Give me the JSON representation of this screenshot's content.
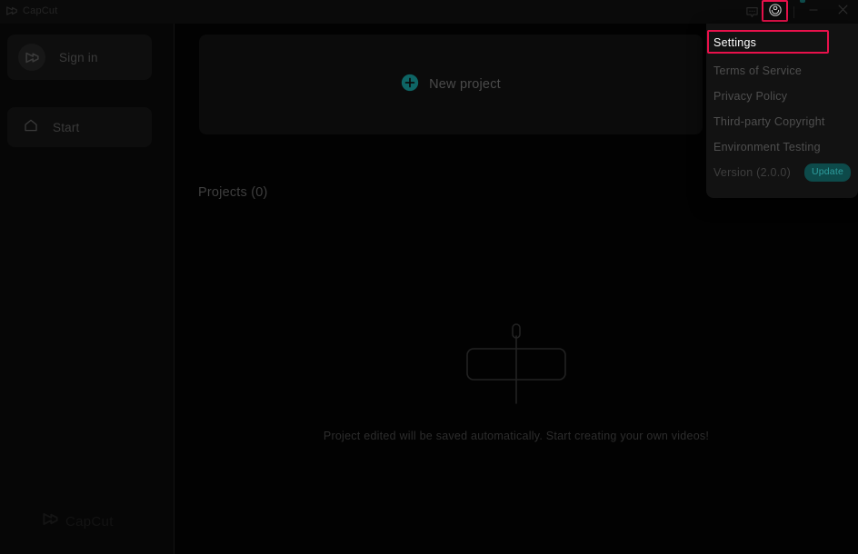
{
  "app": {
    "name": "CapCut",
    "accent_teal": "#0e7c7c",
    "highlight_red": "#e8114b",
    "window_bg": "#000000",
    "sidebar_bg": "#060606",
    "menu_bg": "#121212"
  },
  "titlebar": {
    "logo_text": "CapCut",
    "logo_icon": "capcut-logo-icon",
    "feedback_icon": "chat-bubble-icon",
    "settings_icon": "settings-gear-icon",
    "minimize_icon": "minimize-icon",
    "close_icon": "close-icon"
  },
  "sidebar": {
    "signin": {
      "label": "Sign in",
      "icon": "capcut-avatar-icon"
    },
    "start": {
      "label": "Start",
      "icon": "home-icon"
    },
    "watermark": {
      "text": "CapCut",
      "icon": "capcut-logo-icon"
    }
  },
  "main": {
    "new_project": {
      "label": "New project",
      "icon": "plus-circle-icon"
    },
    "projects_heading": "Projects (0)",
    "empty_state": {
      "illustration": "timeline-clip-playhead-icon",
      "caption": "Project edited will be saved automatically. Start creating your own videos!"
    }
  },
  "dropdown": {
    "items": [
      {
        "label": "Settings",
        "name": "menu-item-settings",
        "highlighted": true
      },
      {
        "label": "Terms of Service",
        "name": "menu-item-terms-of-service"
      },
      {
        "label": "Privacy Policy",
        "name": "menu-item-privacy-policy"
      },
      {
        "label": "Third-party Copyright",
        "name": "menu-item-third-party-copyright"
      },
      {
        "label": "Environment Testing",
        "name": "menu-item-environment-testing"
      }
    ],
    "version": {
      "label": "Version (2.0.0)",
      "badge": "Update"
    }
  }
}
